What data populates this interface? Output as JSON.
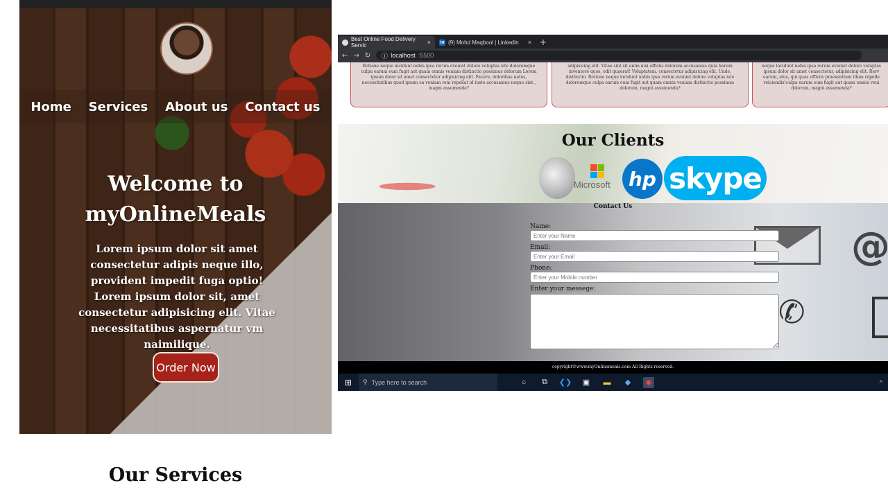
{
  "left_page": {
    "nav": [
      "Home",
      "Services",
      "About us",
      "Contact us"
    ],
    "hero_title": "Welcome to myOnlineMeals",
    "hero_text_1": "Lorem ipsum dolor sit amet consectetur adipis neque illo, provident impedit fuga optio!",
    "hero_text_2": "Lorem ipsum dolor sit, amet consectetur adipisicing elit. Vitae necessitatibus aspernatur vm naimilique.",
    "order_button": "Order Now",
    "services_heading": "Our Services"
  },
  "browser": {
    "tabs": [
      {
        "title": "Best Online Food Delivery Servic",
        "close": "×"
      },
      {
        "title": "(9) Mohd Maqbool | LinkedIn",
        "close": "×"
      }
    ],
    "new_tab": "+",
    "address_host": "localhost",
    "address_port": ":5500"
  },
  "cards": [
    "Rotione neque incidunt nobis ipsa rerum eveniet dolore voluptas iste doloremque culpa earum eum fugit aut quam omnis veniam distinctio possimus dolorum Lorem ipsum dolor sit amet consectetur adipisicing elit. Facere, doloribus natus, necessitatibus quod ipsam ea veniam rem repellat id iusto accusamus neque sint., magni assumenda?",
    "adipisicing elit. Vitae sint sit enim nisi officiis dolorem accusamus quia harum inventore quos, odit quaerat! Voluptatem. consectetur adipisicing elit. Unde, distinctio. Rotione neque incidunt nobis ipsa rerum eveniet dolore voluptas iste doloremque culpa earum eum fugit aut quam omnis veniam distinctio possimus dolorum, magni assumenda?",
    "neque incidunt nobis ipsa rerum eveniet dolore voluptas ipsum dolor sit amet consectetur, adipisicing elit. Rerv earum, eius, qui quas officiis praesentium illum repelle reiciendis!culpa earum eum fugit aut quam omnis veni dolorum, magni assumenda?"
  ],
  "clients": {
    "heading": "Our Clients",
    "logos": {
      "microsoft": "Microsoft",
      "hp": "hp",
      "skype": "skype"
    }
  },
  "contact": {
    "heading": "Contact Us",
    "name_label": "Name:",
    "name_placeholder": "Enter your Name",
    "email_label": "Email:",
    "email_placeholder": "Enter your Email",
    "phone_label": "Phone:",
    "phone_placeholder": "Enter your Mobile number",
    "message_label": "Enter your messege:"
  },
  "footer": "copyright©www.myOnlinemeals.com All Rights reserved.",
  "taskbar": {
    "search_placeholder": "Type here to search"
  },
  "colors": {
    "order_button": "#a5231a",
    "card_bg": "#e5d6d6",
    "card_border": "#cc5555",
    "skype": "#00aff0",
    "hp": "#0a76c9",
    "taskbar": "#0f1b2c"
  }
}
